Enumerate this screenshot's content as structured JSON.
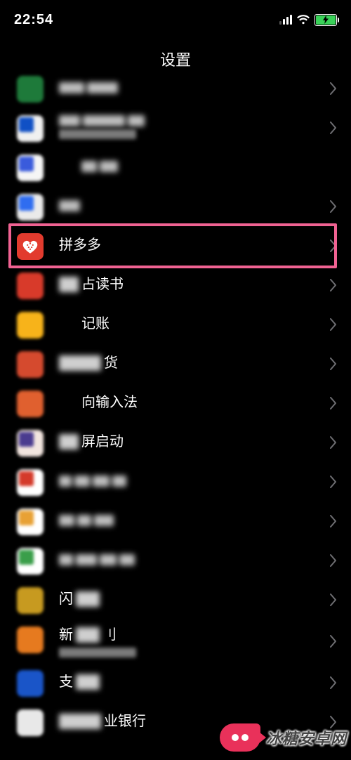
{
  "statusbar": {
    "time": "22:54"
  },
  "header": {
    "title": "设置"
  },
  "highlight_index": 4,
  "rows": [
    {
      "icon_color": "#1e7a3a",
      "label": "",
      "blurred": true,
      "sub_blur": false,
      "chevron": true,
      "pix": [
        36,
        44
      ]
    },
    {
      "icon_color": "#1050c5",
      "icon_bg": "#f0f0f0",
      "label": "",
      "blurred": true,
      "sub_blur": true,
      "chevron": true,
      "pix": [
        30,
        60,
        24
      ]
    },
    {
      "icon_color": "#3a5bdc",
      "icon_bg": "#f5f5f5",
      "label": "",
      "blurred": true,
      "sub_blur": false,
      "chevron": false,
      "pix": [
        22,
        26
      ],
      "indent": true,
      "short": true
    },
    {
      "icon_color": "#2f6df0",
      "icon_bg": "#eaeaea",
      "label": "",
      "blurred": true,
      "sub_blur": false,
      "chevron": true,
      "pix": [
        30
      ],
      "short": true
    },
    {
      "icon_color": "#e23b2e",
      "label": "拼多多",
      "blurred": false,
      "chevron": true,
      "special": "pdd"
    },
    {
      "icon_color": "#d83a2a",
      "label": "占读书",
      "blurred": false,
      "chevron": true,
      "partial_blur_prefix": true
    },
    {
      "icon_color": "#f7b31a",
      "label": "记账",
      "blurred": false,
      "chevron": true,
      "indent": true
    },
    {
      "icon_color": "#d54a2e",
      "label": "货",
      "blurred": false,
      "chevron": true,
      "partial_blur_prefix": true,
      "prefix_wide": true
    },
    {
      "icon_color": "#e0602f",
      "label": "向输入法",
      "blurred": false,
      "chevron": true,
      "indent": true
    },
    {
      "icon_color": "#4a3b8f",
      "icon_bg": "#f2e5df",
      "label": "屏启动",
      "blurred": false,
      "chevron": true,
      "partial_blur_prefix": true
    },
    {
      "icon_color": "#d43a2a",
      "icon_bg": "#ffffff",
      "label": "",
      "blurred": true,
      "chevron": true,
      "pix": [
        18,
        22,
        24,
        20
      ],
      "short": true
    },
    {
      "icon_color": "#e8a135",
      "icon_bg": "#ffffff",
      "label": "",
      "blurred": true,
      "chevron": true,
      "pix": [
        22,
        20,
        28
      ],
      "short": true
    },
    {
      "icon_color": "#3a9e4a",
      "icon_bg": "#ffffff",
      "label": "",
      "blurred": true,
      "chevron": true,
      "pix": [
        20,
        30,
        24,
        22
      ],
      "short": true
    },
    {
      "icon_color": "#c79a20",
      "label": "闪",
      "blurred": false,
      "chevron": true,
      "partial_blur_suffix": true
    },
    {
      "icon_color": "#e67a1f",
      "label": "新",
      "blurred": false,
      "chevron": true,
      "partial_blur_suffix": true,
      "suffix2": "刂",
      "sub_blur": true
    },
    {
      "icon_color": "#1a55c8",
      "label": "支",
      "blurred": false,
      "chevron": true,
      "partial_blur_suffix": true,
      "cut": true
    },
    {
      "icon_color": "#e8e8e8",
      "label": "业银行",
      "blurred": false,
      "chevron": true,
      "partial_blur_prefix": true,
      "prefix_wide": true,
      "cut": true
    }
  ],
  "watermark": {
    "text": "冰糖安卓网"
  }
}
